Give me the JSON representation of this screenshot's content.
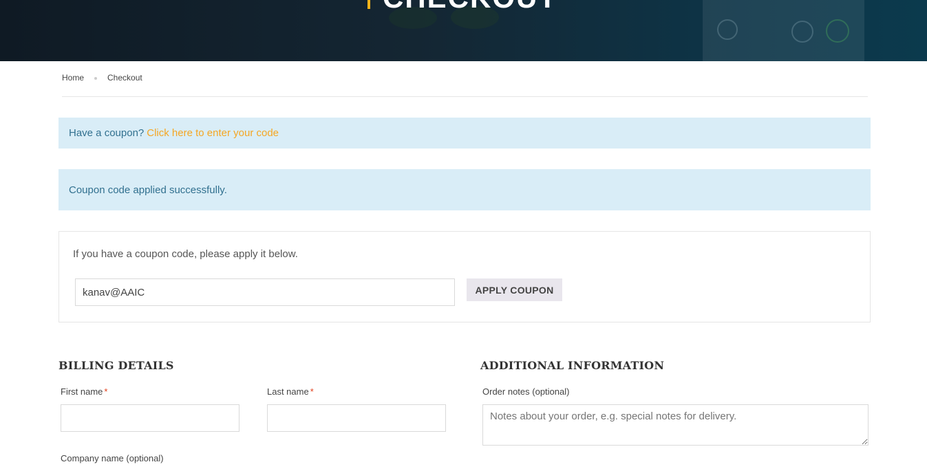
{
  "hero": {
    "title": "CHECKOUT",
    "accent_color": "#f5b31a"
  },
  "breadcrumb": {
    "home": "Home",
    "current": "Checkout"
  },
  "notices": {
    "coupon_prompt": "Have a coupon?",
    "coupon_link": "Click here to enter your code",
    "success": "Coupon code applied successfully."
  },
  "coupon_form": {
    "hint": "If you have a coupon code, please apply it below.",
    "value": "kanav@AAIC",
    "apply_label": "APPLY COUPON"
  },
  "billing": {
    "title": "BILLING DETAILS",
    "first_name_label": "First name",
    "last_name_label": "Last name",
    "company_label": "Company name (optional)",
    "required_mark": "*"
  },
  "additional": {
    "title": "ADDITIONAL INFORMATION",
    "notes_label": "Order notes (optional)",
    "notes_placeholder": "Notes about your order, e.g. special notes for delivery."
  },
  "colors": {
    "notice_bg": "#d9edf7",
    "notice_text": "#31708f",
    "link": "#f5a623",
    "required": "#e2401c"
  }
}
